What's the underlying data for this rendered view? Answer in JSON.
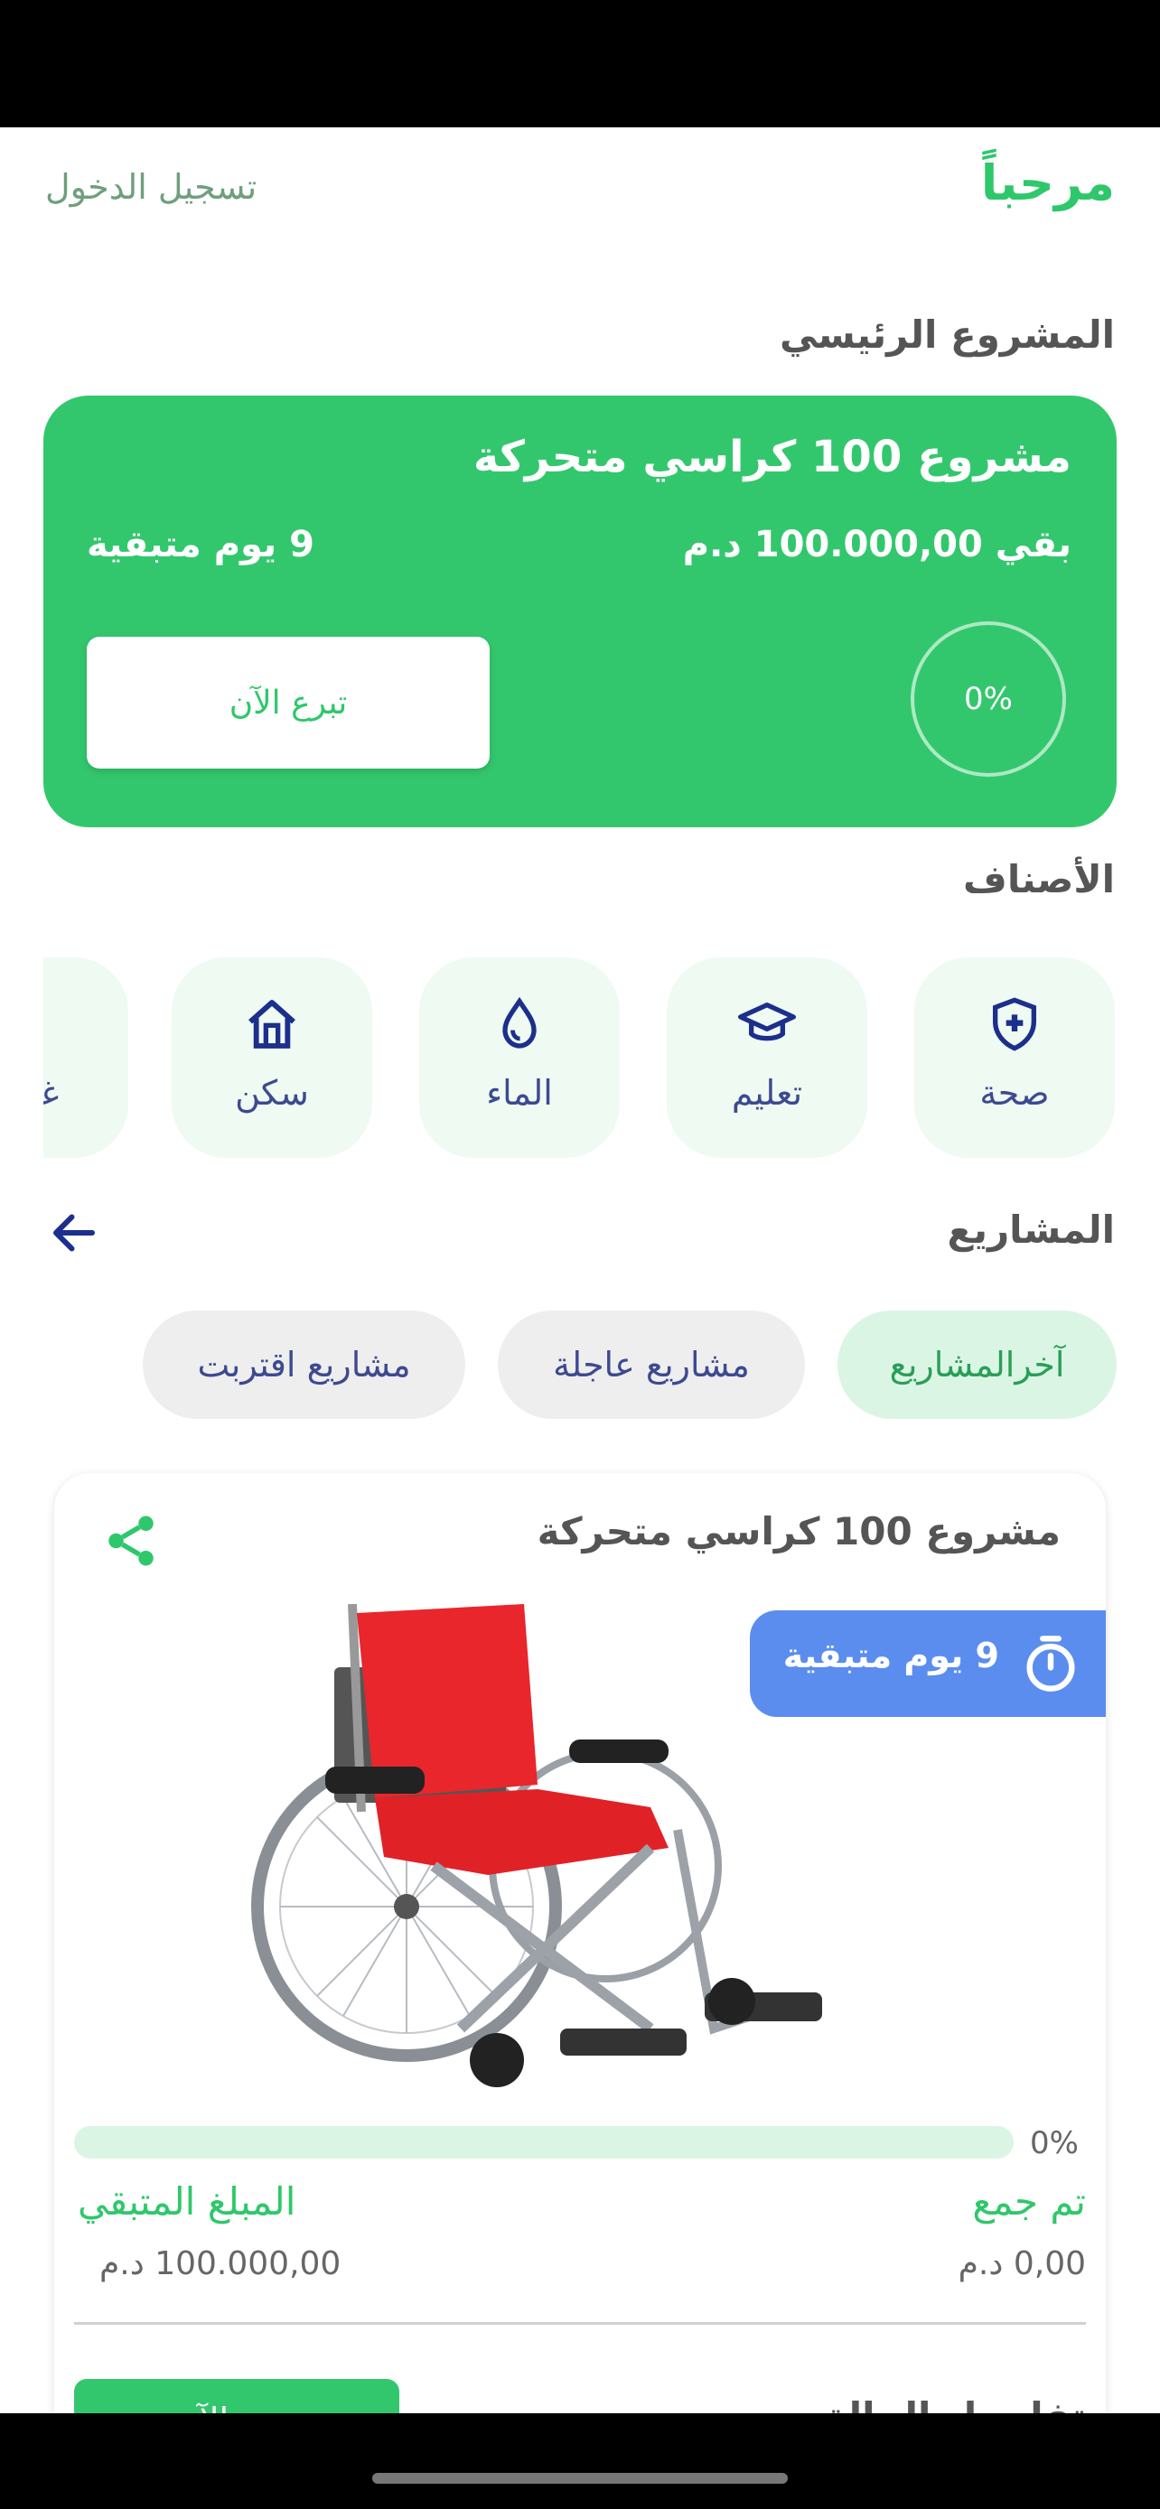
{
  "header": {
    "welcome": "مرحباً",
    "login": "تسجيل الدخول"
  },
  "main_project": {
    "section_title": "المشروع الرئيسي",
    "title": "مشروع 100 كراسي متحركة",
    "remaining": "بقي 100.000,00 د.م",
    "days_left": "9 يوم متبقية",
    "progress": "0%",
    "donate_label": "تبرع الآن"
  },
  "categories": {
    "section_title": "الأصناف",
    "items": [
      {
        "label": "صحة",
        "icon": "health-shield-icon"
      },
      {
        "label": "تعليم",
        "icon": "graduation-cap-icon"
      },
      {
        "label": "الماء",
        "icon": "water-drop-icon"
      },
      {
        "label": "سكن",
        "icon": "house-icon"
      },
      {
        "label": "غذاء",
        "icon": "food-icon"
      }
    ]
  },
  "projects": {
    "section_title": "المشاريع",
    "tabs": [
      {
        "label": "آخرالمشاريع",
        "active": true
      },
      {
        "label": "مشاريع عاجلة",
        "active": false
      },
      {
        "label": "مشاريع اقتربت",
        "active": false
      }
    ]
  },
  "project_card": {
    "title": "مشروع 100 كراسي متحركة",
    "badge": "9 يوم متبقية",
    "progress_pct": "0%",
    "progress_fraction": 0,
    "collected_label": "تم جمع",
    "collected_value": "0,00 د.م",
    "remaining_label": "المبلغ المتبقي",
    "remaining_value": "100.000,00 د.م",
    "donate_label": "تبرع الآن",
    "details_label": "تفاصيل الحالة"
  },
  "colors": {
    "brand_green": "#33c76d",
    "badge_blue": "#5b8def",
    "icon_navy": "#1c2f8c"
  }
}
